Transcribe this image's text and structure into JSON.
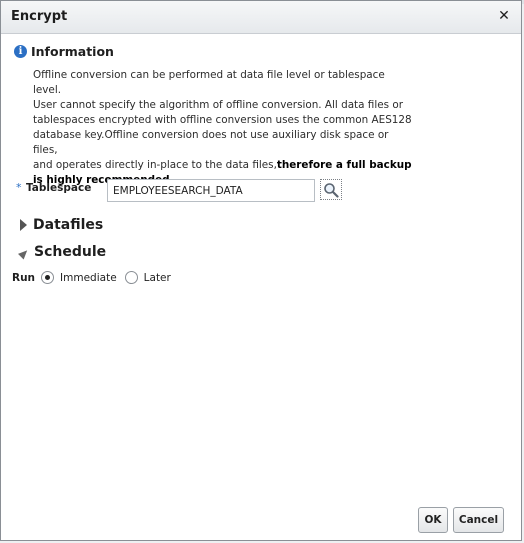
{
  "dialog": {
    "title": "Encrypt",
    "close_symbol": "✕"
  },
  "information": {
    "icon": "info-icon",
    "heading": "Information",
    "text_lines": [
      "Offline conversion can be performed at data file level or tablespace level.",
      "User cannot specify the algorithm of offline conversion. All data files or",
      "tablespaces encrypted with offline conversion uses the common AES128",
      "database key.Offline conversion does not use auxiliary disk space or files,",
      "and operates directly in-place to the data files,"
    ],
    "bold_tail": "therefore a full backup",
    "bold_line2": "is highly recommended"
  },
  "tablespace": {
    "required_marker": "*",
    "label": "Tablespace",
    "value": "EMPLOYEESEARCH_DATA",
    "search_icon": "magnifier-icon"
  },
  "sections": {
    "datafiles": "Datafiles",
    "schedule": "Schedule"
  },
  "run": {
    "label": "Run",
    "options": [
      "Immediate",
      "Later"
    ],
    "selected": "Immediate"
  },
  "buttons": {
    "ok": "OK",
    "cancel": "Cancel"
  },
  "colors": {
    "accent": "#2b6fc4",
    "border": "#8a8f95"
  }
}
